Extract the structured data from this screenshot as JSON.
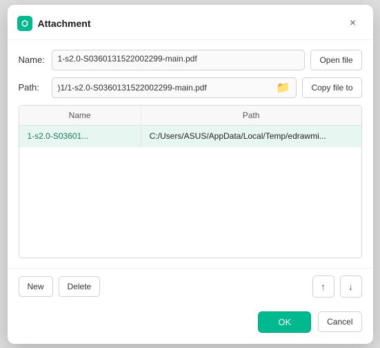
{
  "dialog": {
    "title": "Attachment",
    "close_label": "×"
  },
  "name_row": {
    "label": "Name:",
    "value": "1-s2.0-S0360131522002299-main.pdf",
    "open_file_btn": "Open file"
  },
  "path_row": {
    "label": "Path:",
    "value": ")1/1-s2.0-S0360131522002299-main.pdf",
    "copy_file_btn": "Copy file to"
  },
  "table": {
    "columns": [
      "Name",
      "Path"
    ],
    "rows": [
      {
        "name": "1-s2.0-S03601...",
        "path": "C:/Users/ASUS/AppData/Local/Temp/edrawmi..."
      }
    ]
  },
  "bottom_bar": {
    "new_btn": "New",
    "delete_btn": "Delete",
    "up_arrow": "↑",
    "down_arrow": "↓"
  },
  "footer": {
    "ok_btn": "OK",
    "cancel_btn": "Cancel"
  },
  "icons": {
    "folder": "🗂",
    "app": "M"
  }
}
